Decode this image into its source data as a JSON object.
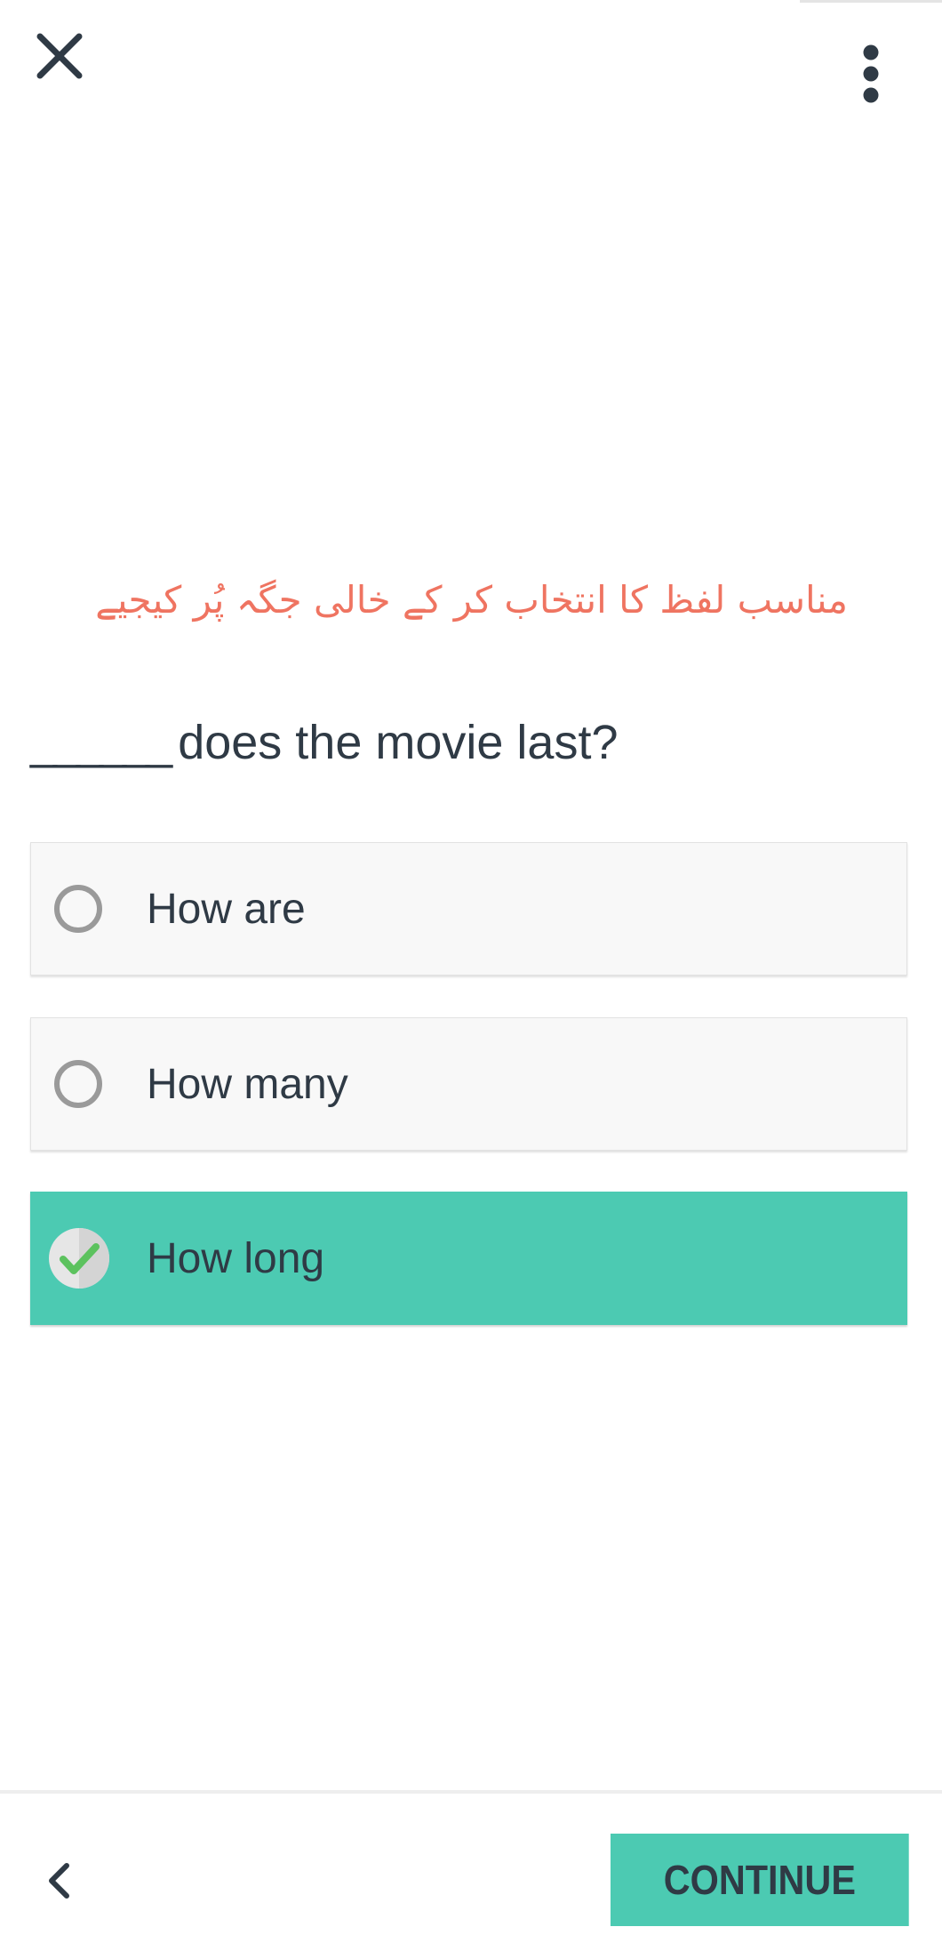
{
  "header": {
    "close_icon": "close-icon",
    "menu_icon": "more-vertical-icon"
  },
  "instruction": "مناسب لفظ کا انتخاب کر کے خالی جگہ پُر کیجیے",
  "question": {
    "blank": "______",
    "text": "does the movie last?"
  },
  "options": [
    {
      "label": "How are",
      "selected": false
    },
    {
      "label": "How many",
      "selected": false
    },
    {
      "label": "How long",
      "selected": true
    }
  ],
  "footer": {
    "back_icon": "chevron-left-icon",
    "continue_label": "CONTINUE"
  },
  "colors": {
    "accent": "#4ccab2",
    "instruction_text": "#ef7461",
    "text": "#2f3a45",
    "check_green": "#5cc25e"
  }
}
